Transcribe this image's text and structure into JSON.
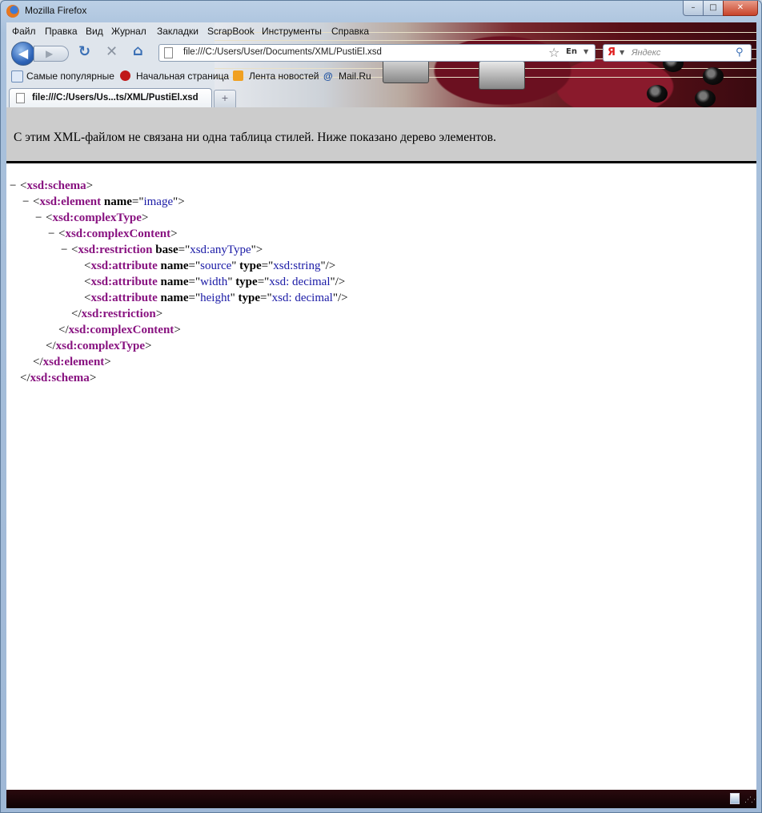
{
  "window": {
    "title": "Mozilla Firefox"
  },
  "caption_buttons": {
    "minimize": "–",
    "maximize": "□",
    "close": "✕"
  },
  "menu": [
    "Файл",
    "Правка",
    "Вид",
    "Журнал",
    "Закладки",
    "ScrapBook",
    "Инструменты",
    "Справка"
  ],
  "nav": {
    "url": "file:///C:/Users/User/Documents/XML/PustiEl.xsd",
    "lang": "En",
    "search_placeholder": "Яндекс",
    "search_engine": "Я"
  },
  "bookmarks": [
    "Самые популярные",
    "Начальная страница",
    "Лента новостей",
    "Mail.Ru"
  ],
  "tabs": [
    {
      "label": "file:///C:/Users/Us...ts/XML/PustiEl.xsd"
    }
  ],
  "new_tab_label": "+",
  "xml_viewer": {
    "message": "С этим XML-файлом не связана ни одна таблица стилей. Ниже показано дерево элементов.",
    "toggle": "−",
    "lines": {
      "l1": {
        "open": "xsd:schema"
      },
      "l2": {
        "open": "xsd:element",
        "a1n": "name",
        "a1v": "image"
      },
      "l3": {
        "open": "xsd:complexType"
      },
      "l4": {
        "open": "xsd:complexContent"
      },
      "l5": {
        "open": "xsd:restriction",
        "a1n": "base",
        "a1v": "xsd:anyType"
      },
      "l6": {
        "open": "xsd:attribute",
        "a1n": "name",
        "a1v": "source",
        "a2n": "type",
        "a2v": "xsd:string"
      },
      "l7": {
        "open": "xsd:attribute",
        "a1n": "name",
        "a1v": "width",
        "a2n": "type",
        "a2v": "xsd: decimal"
      },
      "l8": {
        "open": "xsd:attribute",
        "a1n": "name",
        "a1v": "height",
        "a2n": "type",
        "a2v": "xsd: decimal"
      },
      "l9": {
        "close": "xsd:restriction"
      },
      "l10": {
        "close": "xsd:complexContent"
      },
      "l11": {
        "close": "xsd:complexType"
      },
      "l12": {
        "close": "xsd:element"
      },
      "l13": {
        "close": "xsd:schema"
      }
    }
  },
  "colors": {
    "tag": "#881280",
    "attr_value": "#1a1aa6",
    "header_bg": "#cccccc"
  }
}
